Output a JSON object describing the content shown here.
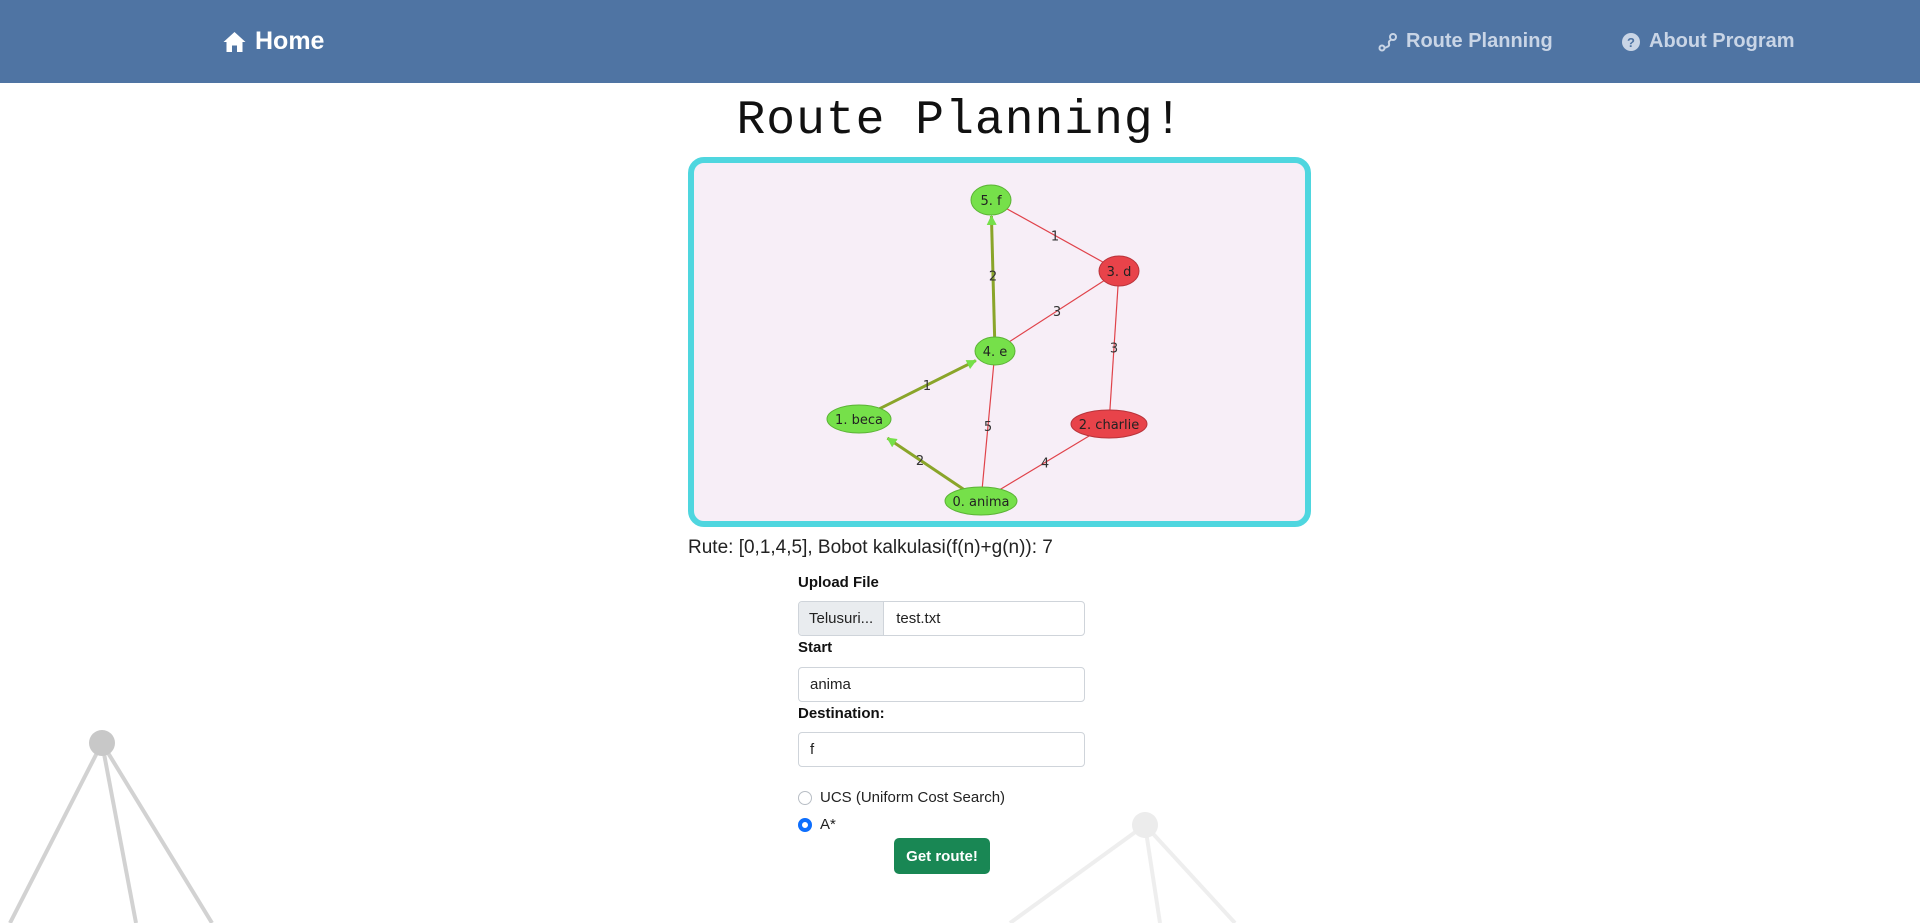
{
  "nav": {
    "home_label": "Home",
    "route_planning_label": "Route Planning",
    "about_label": "About Program"
  },
  "page": {
    "title": "Route Planning!"
  },
  "graph": {
    "nodes": [
      {
        "id": "0",
        "label": "0. anima",
        "on_route": true
      },
      {
        "id": "1",
        "label": "1. beca",
        "on_route": true
      },
      {
        "id": "2",
        "label": "2. charlie",
        "on_route": false
      },
      {
        "id": "3",
        "label": "3. d",
        "on_route": false
      },
      {
        "id": "4",
        "label": "4. e",
        "on_route": true
      },
      {
        "id": "5",
        "label": "5. f",
        "on_route": true
      }
    ],
    "edges": [
      {
        "from": "0",
        "to": "1",
        "weight": "2",
        "on_route": true
      },
      {
        "from": "1",
        "to": "4",
        "weight": "1",
        "on_route": true
      },
      {
        "from": "4",
        "to": "5",
        "weight": "2",
        "on_route": true
      },
      {
        "from": "0",
        "to": "4",
        "weight": "5",
        "on_route": false
      },
      {
        "from": "0",
        "to": "2",
        "weight": "4",
        "on_route": false
      },
      {
        "from": "2",
        "to": "3",
        "weight": "3",
        "on_route": false
      },
      {
        "from": "4",
        "to": "3",
        "weight": "3",
        "on_route": false
      },
      {
        "from": "5",
        "to": "3",
        "weight": "1",
        "on_route": false
      }
    ],
    "colors": {
      "route_node": "#76e04a",
      "other_node": "#e8434a",
      "route_edge": "#8aa52a",
      "other_edge": "#e0424a",
      "arrow": "#76e04a"
    }
  },
  "result": {
    "text": "Rute: [0,1,4,5], Bobot kalkulasi(f(n)+g(n)): 7"
  },
  "form": {
    "upload_label": "Upload File",
    "browse_label": "Telusuri...",
    "file_name": "test.txt",
    "start_label": "Start",
    "start_value": "anima",
    "destination_label": "Destination:",
    "destination_value": "f",
    "options": [
      {
        "label": "UCS (Uniform Cost Search)",
        "checked": false
      },
      {
        "label": "A*",
        "checked": true
      }
    ],
    "submit_label": "Get route!"
  },
  "theme": {
    "navbar": "#4f74a3",
    "frame_border": "#4fd6df",
    "graph_bg": "#f7eef7",
    "submit": "#198754",
    "radio_checked": "#0d6efd"
  }
}
